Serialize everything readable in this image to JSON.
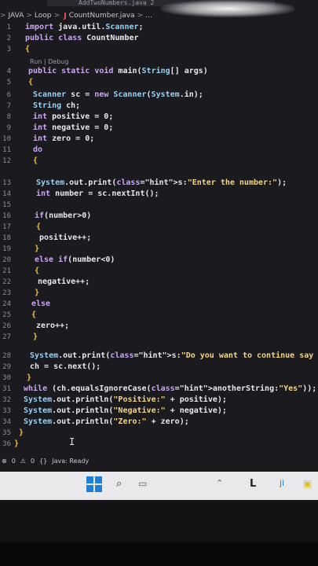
{
  "tab": {
    "label": "AddTwoNumbers.java 2"
  },
  "breadcrumb": {
    "root": "JAVA",
    "folder": "Loop",
    "file_icon": "J",
    "file": "CountNumber.java",
    "more": "..."
  },
  "codelens": "Run | Debug",
  "code_lines": [
    {
      "n": "1",
      "t": "import java.util.Scanner;"
    },
    {
      "n": "2",
      "t": "public class CountNumber"
    },
    {
      "n": "3",
      "t": "{"
    },
    {
      "n": "4",
      "t": "public static void main(String[] args)"
    },
    {
      "n": "5",
      "t": "{"
    },
    {
      "n": "6",
      "t": "Scanner sc = new Scanner(System.in);"
    },
    {
      "n": "7",
      "t": "String ch;"
    },
    {
      "n": "8",
      "t": "int positive = 0;"
    },
    {
      "n": "9",
      "t": "int negative = 0;"
    },
    {
      "n": "10",
      "t": "int zero = 0;"
    },
    {
      "n": "11",
      "t": "do"
    },
    {
      "n": "12",
      "t": "{"
    },
    {
      "n": "13",
      "t": "System.out.print(s:\"Enter the number:\");"
    },
    {
      "n": "14",
      "t": "int number = sc.nextInt();"
    },
    {
      "n": "15",
      "t": ""
    },
    {
      "n": "16",
      "t": "if(number>0)"
    },
    {
      "n": "17",
      "t": "{"
    },
    {
      "n": "18",
      "t": "positive++;"
    },
    {
      "n": "19",
      "t": "}"
    },
    {
      "n": "20",
      "t": "else if(number<0)"
    },
    {
      "n": "21",
      "t": "{"
    },
    {
      "n": "22",
      "t": "negative++;"
    },
    {
      "n": "23",
      "t": "}"
    },
    {
      "n": "24",
      "t": "else"
    },
    {
      "n": "25",
      "t": "{"
    },
    {
      "n": "26",
      "t": "zero++;"
    },
    {
      "n": "27",
      "t": "}"
    },
    {
      "n": "28",
      "t": "System.out.print(s:\"Do you want to continue say Yes/No:\");"
    },
    {
      "n": "29",
      "t": "ch = sc.next();"
    },
    {
      "n": "30",
      "t": "}"
    },
    {
      "n": "31",
      "t": "while (ch.equalsIgnoreCase(anotherString:\"Yes\"));"
    },
    {
      "n": "32",
      "t": "System.out.println(\"Positive:\" + positive);"
    },
    {
      "n": "33",
      "t": "System.out.println(\"Negative:\" + negative);"
    },
    {
      "n": "34",
      "t": "System.out.println(\"Zero:\" + zero);"
    },
    {
      "n": "35",
      "t": "}"
    },
    {
      "n": "36",
      "t": "}"
    }
  ],
  "status": {
    "problems": "0",
    "warnings": "0",
    "java_status": "Java: Ready"
  },
  "colors": {
    "keyword": "#c8a8f0",
    "type": "#9ad0f0",
    "string": "#f0d48a",
    "bracket": "#f4c242",
    "editor_bg": "#1b1a1f",
    "taskbar_bg": "#e9e9ec",
    "windows_blue": "#1d7fd6"
  }
}
